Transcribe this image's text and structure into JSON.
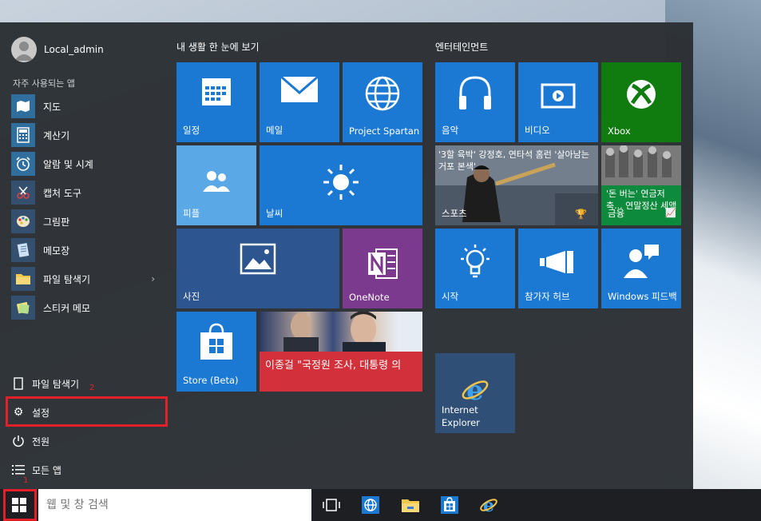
{
  "user": {
    "name": "Local_admin"
  },
  "frequent_label": "자주 사용되는 앱",
  "apps": [
    {
      "label": "지도",
      "icon": "maps-icon"
    },
    {
      "label": "계산기",
      "icon": "calculator-icon"
    },
    {
      "label": "알람 및 시계",
      "icon": "alarm-clock-icon"
    },
    {
      "label": "캡처 도구",
      "icon": "snipping-tool-icon"
    },
    {
      "label": "그림판",
      "icon": "paint-icon"
    },
    {
      "label": "메모장",
      "icon": "notepad-icon"
    },
    {
      "label": "파일 탐색기",
      "icon": "file-explorer-icon"
    },
    {
      "label": "스티커 메모",
      "icon": "sticky-notes-icon"
    }
  ],
  "bottom": {
    "file_explorer": "파일 탐색기",
    "settings": "설정",
    "power": "전원",
    "all_apps": "모든 앱"
  },
  "markers": {
    "start": "1",
    "settings": "2"
  },
  "groups": {
    "life": "내 생활 한 눈에 보기",
    "entertainment": "엔터테인먼트"
  },
  "tiles": {
    "calendar": "일정",
    "mail": "메일",
    "spartan": "Project Spartan",
    "people": "피플",
    "weather": "날씨",
    "photos": "사진",
    "onenote": "OneNote",
    "store": "Store (Beta)",
    "news_headline": "이종걸 \"국정원 조사, 대통령 의",
    "music": "음악",
    "video": "비디오",
    "xbox": "Xbox",
    "sports_headline": "'3할 육박' 강정호, 연타석 홈런 '살아남는 거포 본색'",
    "sports": "스포츠",
    "money_headline": "'돈 버는' 연금저축... 연말정산 세액공제",
    "money": "금융",
    "getstarted": "시작",
    "insider": "참가자 허브",
    "feedback": "Windows 피드백",
    "ie_line1": "Internet",
    "ie_line2": "Explorer"
  },
  "search": {
    "placeholder": "웹 및 창 검색"
  },
  "colors": {
    "accent_blue": "#1b79d4",
    "xbox_green": "#107c10",
    "onenote_purple": "#7b3a8e",
    "news_red": "#d2303a",
    "highlight_red": "#e3202a"
  }
}
